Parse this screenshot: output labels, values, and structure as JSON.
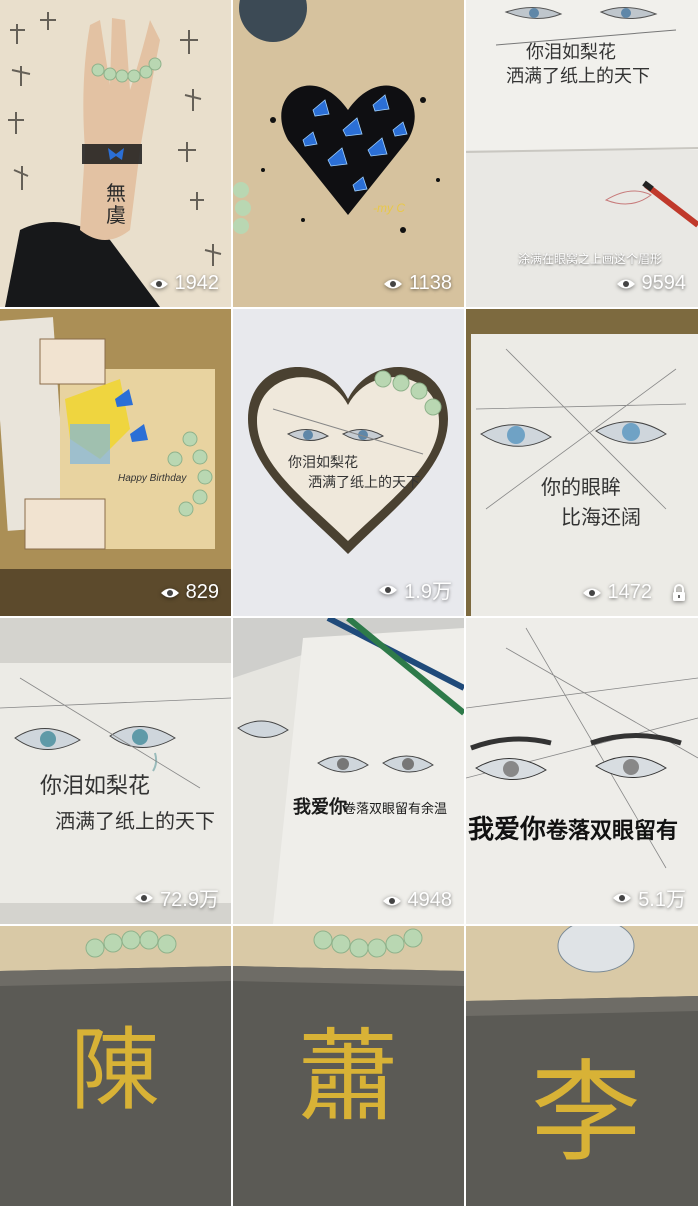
{
  "grid": {
    "posts": [
      {
        "id": "post-1",
        "views": "1942",
        "locked": false,
        "tattoo_text": "無虞"
      },
      {
        "id": "post-2",
        "views": "1138",
        "locked": false,
        "signature": "-my C"
      },
      {
        "id": "post-3",
        "views": "9594",
        "locked": false,
        "subtitle": "涂满在眼窝之上画这个眉形",
        "drawing_text": [
          "你泪如梨花",
          "洒满了纸上的天下"
        ]
      },
      {
        "id": "post-4",
        "views": "829",
        "locked": false,
        "card_text": "Happy Birthday"
      },
      {
        "id": "post-5",
        "views": "1.9万",
        "locked": false,
        "drawing_text": [
          "你泪如梨花",
          "洒满了纸上的天下"
        ]
      },
      {
        "id": "post-6",
        "views": "1472",
        "locked": true,
        "drawing_text": [
          "你的眼眸",
          "比海还阔"
        ]
      },
      {
        "id": "post-7",
        "views": "72.9万",
        "locked": false,
        "drawing_text": [
          "你泪如梨花",
          "洒满了纸上的天下"
        ]
      },
      {
        "id": "post-8",
        "views": "4948",
        "locked": false,
        "drawing_text": [
          "我爱你",
          "卷落双眼留有余温"
        ]
      },
      {
        "id": "post-9",
        "views": "5.1万",
        "locked": false,
        "drawing_text": [
          "我爱你",
          "卷落双眼留有"
        ]
      },
      {
        "id": "post-10",
        "views": "",
        "locked": false,
        "stone_char": "陳"
      },
      {
        "id": "post-11",
        "views": "",
        "locked": false,
        "stone_char": "蕭"
      },
      {
        "id": "post-12",
        "views": "",
        "locked": false,
        "stone_char": "李"
      }
    ]
  },
  "icons": {
    "views": "eye-icon",
    "lock": "lock-icon"
  },
  "colors": {
    "overlay_text": "#ffffff",
    "paper": "#ecebe6",
    "kraft": "#d7c29c",
    "stone": "#5b5a55",
    "gold": "#d8b236",
    "butterfly": "#2b6fd6"
  }
}
